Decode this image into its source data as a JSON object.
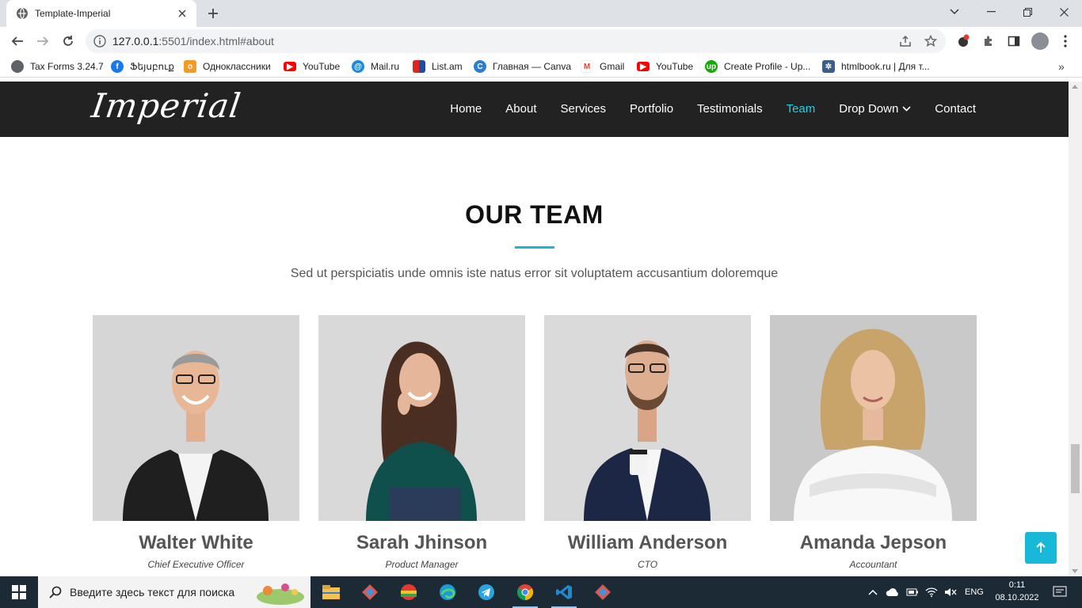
{
  "browser": {
    "tab_title": "Template-Imperial",
    "url_host": "127.0.0.1",
    "url_rest": ":5501/index.html#about",
    "bookmarks": [
      {
        "label": "Tax Forms 3.24.7",
        "icon": "globe-icon",
        "color": "#5f6368"
      },
      {
        "label": "Ֆեյսբուք",
        "icon": "facebook-icon",
        "color": "#1877f2"
      },
      {
        "label": "Одноклассники",
        "icon": "ok-icon",
        "color": "#f59a23"
      },
      {
        "label": "YouTube",
        "icon": "youtube-icon",
        "color": "#ff0000"
      },
      {
        "label": "Mail.ru",
        "icon": "mailru-icon",
        "color": "#168de2"
      },
      {
        "label": "List.am",
        "icon": "listam-icon",
        "color": "#e1261c"
      },
      {
        "label": "Главная — Canva",
        "icon": "canva-icon",
        "color": "#2d7dd2"
      },
      {
        "label": "Gmail",
        "icon": "gmail-icon",
        "color": "#ea4335"
      },
      {
        "label": "YouTube",
        "icon": "youtube-icon",
        "color": "#ff0000"
      },
      {
        "label": "Create Profile - Up...",
        "icon": "upwork-icon",
        "color": "#14a800"
      },
      {
        "label": "htmlbook.ru | Для т...",
        "icon": "htmlbook-icon",
        "color": "#3b5f8a"
      }
    ]
  },
  "site": {
    "logo": "Imperial",
    "nav": [
      "Home",
      "About",
      "Services",
      "Portfolio",
      "Testimonials",
      "Team",
      "Drop Down",
      "Contact"
    ],
    "active_nav": "Team",
    "accent": "#18b8d8"
  },
  "team": {
    "title": "OUR TEAM",
    "subtitle": "Sed ut perspiciatis unde omnis iste natus error sit voluptatem accusantium doloremque",
    "members": [
      {
        "name": "Walter White",
        "role": "Chief Executive Officer"
      },
      {
        "name": "Sarah Jhinson",
        "role": "Product Manager"
      },
      {
        "name": "William Anderson",
        "role": "CTO"
      },
      {
        "name": "Amanda Jepson",
        "role": "Accountant"
      }
    ]
  },
  "taskbar": {
    "search_placeholder": "Введите здесь текст для поиска",
    "lang": "ENG",
    "time": "0:11",
    "date": "08.10.2022"
  }
}
